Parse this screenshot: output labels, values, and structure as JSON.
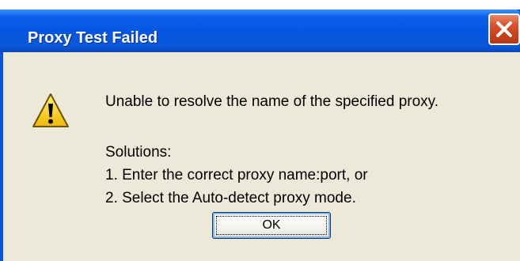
{
  "dialog": {
    "title": "Proxy Test Failed",
    "close_icon": "close-icon",
    "warning_icon": "warning-icon",
    "message": "Unable to resolve the name of the specified proxy.",
    "solutions_heading": "Solutions:",
    "solutions": [
      "1. Enter the correct proxy name:port, or",
      "2. Select the Auto-detect proxy mode."
    ],
    "ok_label": "OK"
  },
  "colors": {
    "titlebar": "#0655e0",
    "client_background": "#ece9d8",
    "close_button": "#d9522c",
    "warning_fill": "#ffd200"
  }
}
